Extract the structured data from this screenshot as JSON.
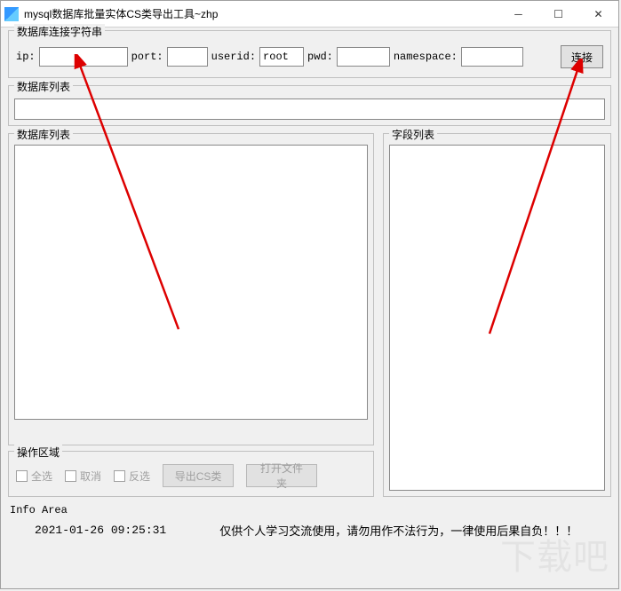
{
  "window": {
    "title": "mysql数据库批量实体CS类导出工具~zhp"
  },
  "conn": {
    "legend": "数据库连接字符串",
    "ip_label": "ip:",
    "ip_value": "",
    "port_label": "port:",
    "port_value": "",
    "userid_label": "userid:",
    "userid_value": "root",
    "pwd_label": "pwd:",
    "pwd_value": "",
    "namespace_label": "namespace:",
    "namespace_value": "",
    "connect_btn": "连接"
  },
  "db_list1": {
    "legend": "数据库列表",
    "value": ""
  },
  "db_list2": {
    "legend": "数据库列表"
  },
  "fields": {
    "legend": "字段列表"
  },
  "ops": {
    "legend": "操作区域",
    "select_all": "全选",
    "cancel": "取消",
    "invert": "反选",
    "export_btn": "导出CS类",
    "open_folder_btn": "打开文件夹"
  },
  "info": {
    "label": "Info Area",
    "timestamp": "2021-01-26 09:25:31",
    "message": "仅供个人学习交流使用，请勿用作不法行为，一律使用后果自负！！！"
  },
  "watermark": "下载吧"
}
